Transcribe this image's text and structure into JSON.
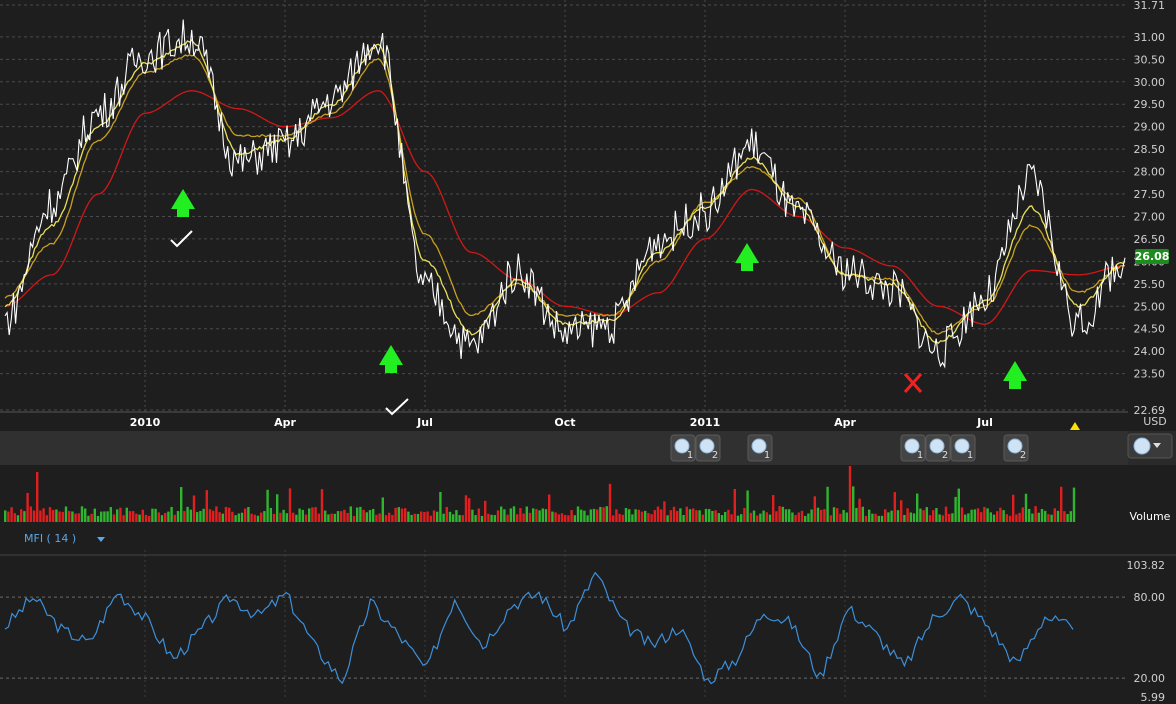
{
  "colors": {
    "price": "#ffffff",
    "ma_short": "#e8e05a",
    "ma_mid": "#c8a020",
    "ma_long": "#d01818",
    "mfi": "#3d8fd8",
    "vol_up": "#2fb52f",
    "vol_down": "#e02020",
    "signal_up": "#22ee22",
    "signal_bad": "#ee2222",
    "badge": "#1c8c1c"
  },
  "price_panel": {
    "currency": "USD",
    "last_price": "26.08",
    "y_ticks": [
      "31.71",
      "31.00",
      "30.50",
      "30.00",
      "29.50",
      "29.00",
      "28.50",
      "28.00",
      "27.50",
      "27.00",
      "26.50",
      "26.00",
      "25.50",
      "25.00",
      "24.50",
      "24.00",
      "23.50",
      "22.69"
    ],
    "x_labels": [
      "2010",
      "Apr",
      "Jul",
      "Oct",
      "2011",
      "Apr",
      "Jul"
    ]
  },
  "news_markers": [
    "1",
    "2",
    "1",
    "1",
    "2",
    "1",
    "2"
  ],
  "volume_panel": {
    "label": "Volume"
  },
  "indicator": {
    "name": "MFI ( 14 )",
    "ticks": [
      "103.82",
      "80.00",
      "20.00",
      "5.99"
    ]
  },
  "chart_data": [
    {
      "type": "line",
      "ylim": [
        22.69,
        31.71
      ],
      "x": [
        "2009-10",
        "2009-11",
        "2009-12",
        "2010-01",
        "2010-02",
        "2010-03",
        "2010-04",
        "2010-05",
        "2010-06",
        "2010-07",
        "2010-08",
        "2010-09",
        "2010-10",
        "2010-11",
        "2010-12",
        "2011-01",
        "2011-02",
        "2011-03",
        "2011-04",
        "2011-05",
        "2011-06",
        "2011-07",
        "2011-08",
        "2011-09",
        "2011-10"
      ],
      "series": [
        {
          "values": [
            24.7,
            27.3,
            29.3,
            30.6,
            31.0,
            28.2,
            28.6,
            29.6,
            31.0,
            25.4,
            24.1,
            25.8,
            24.4,
            24.6,
            26.5,
            27.1,
            28.6,
            27.0,
            25.8,
            25.4,
            24.0,
            25.2,
            27.8,
            24.6,
            26.08
          ]
        },
        {
          "values": [
            25.0,
            26.8,
            29.0,
            30.4,
            30.9,
            28.4,
            28.7,
            29.5,
            30.8,
            26.0,
            24.4,
            25.6,
            24.6,
            24.7,
            26.2,
            27.2,
            28.3,
            27.2,
            25.7,
            25.5,
            24.2,
            25.1,
            27.2,
            25.0,
            26.0
          ]
        },
        {
          "values": [
            25.2,
            26.4,
            28.7,
            30.2,
            30.6,
            28.8,
            28.8,
            29.3,
            30.5,
            26.6,
            24.8,
            25.5,
            24.8,
            24.8,
            26.0,
            27.3,
            28.1,
            27.4,
            25.7,
            25.6,
            24.4,
            25.0,
            26.8,
            25.3,
            25.9
          ]
        },
        {
          "values": [
            25.0,
            25.7,
            27.5,
            29.3,
            29.8,
            29.4,
            29.0,
            29.2,
            29.8,
            28.0,
            26.2,
            25.6,
            25.0,
            24.8,
            25.3,
            26.5,
            27.6,
            27.0,
            26.3,
            25.9,
            25.0,
            24.6,
            25.8,
            25.7,
            25.9
          ]
        }
      ]
    },
    {
      "type": "bar",
      "series": [
        {
          "name": "Volume"
        }
      ]
    },
    {
      "type": "line",
      "ylim": [
        5.99,
        103.82
      ],
      "series": [
        {
          "values": [
            58,
            80,
            56,
            46,
            84,
            64,
            34,
            56,
            80,
            66,
            82,
            44,
            18,
            76,
            52,
            26,
            80,
            44,
            74,
            83,
            56,
            98,
            60,
            44,
            58,
            18,
            34,
            70,
            60,
            20,
            72,
            52,
            28,
            64,
            80,
            58,
            30,
            66,
            56
          ]
        }
      ]
    }
  ]
}
